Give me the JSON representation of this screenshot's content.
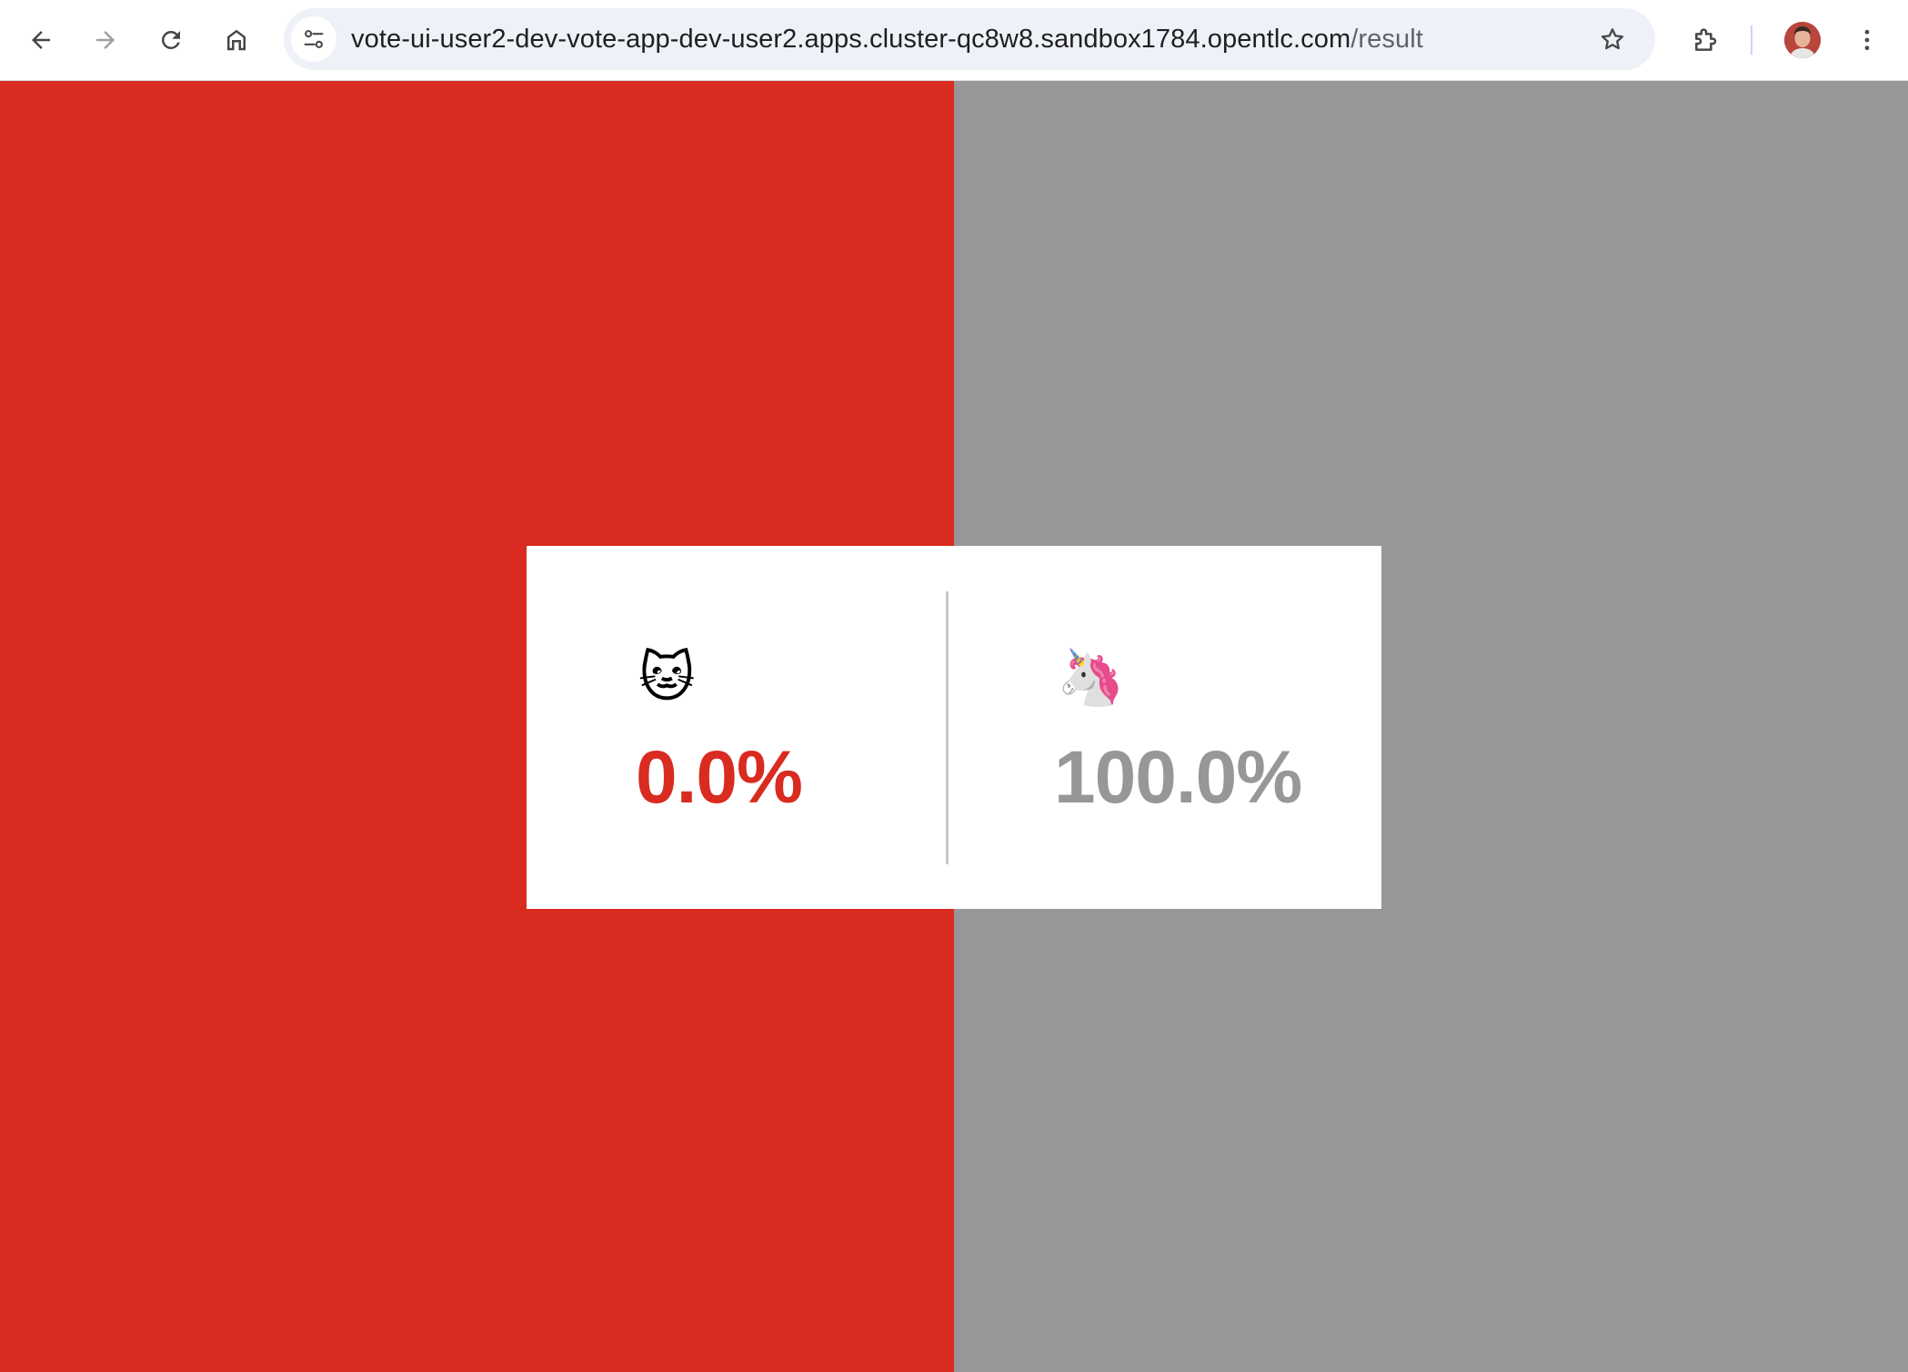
{
  "browser": {
    "url_host": "vote-ui-user2-dev-vote-app-dev-user2.apps.cluster-qc8w8.sandbox1784.opentlc.com",
    "url_path": "/result",
    "icons": {
      "back": "arrow-left-icon",
      "forward": "arrow-right-icon",
      "reload": "reload-icon",
      "home": "home-icon",
      "site_info": "tune-icon",
      "bookmark": "star-icon",
      "extensions": "puzzle-icon",
      "profile": "avatar",
      "menu": "kebab-menu-icon"
    }
  },
  "result": {
    "option_a": {
      "emoji": "🐱",
      "icon": "cat-face-icon",
      "percent_text": "0.0%",
      "percent": 0.0,
      "color": "#d92b1f"
    },
    "option_b": {
      "emoji": "🦄",
      "icon": "unicorn-icon",
      "percent_text": "100.0%",
      "percent": 100.0,
      "color": "#979797"
    }
  }
}
